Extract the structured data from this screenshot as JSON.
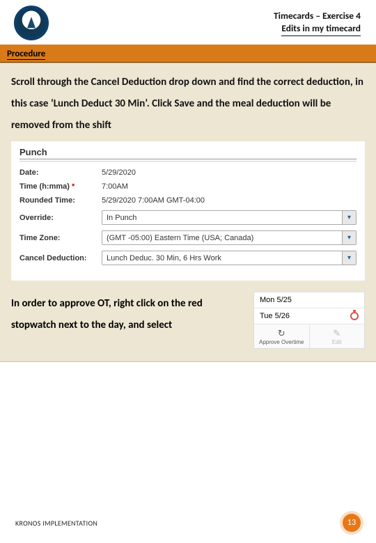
{
  "header": {
    "title_line1": "Timecards – Exercise 4",
    "title_line2": "Edits in my timecard"
  },
  "section_label": "Procedure",
  "instruction_text": "Scroll through the Cancel Deduction drop down and find the correct deduction, in this case ‘Lunch Deduct 30 Min’. Click Save and the meal deduction will be removed from the shift",
  "punch_form": {
    "title": "Punch",
    "rows": {
      "date_label": "Date:",
      "date_value": "5/29/2020",
      "time_label": "Time (h:mma)",
      "time_value": "7:00AM",
      "rounded_label": "Rounded Time:",
      "rounded_value": "5/29/2020 7:00AM GMT-04:00",
      "override_label": "Override:",
      "override_value": "In Punch",
      "tz_label": "Time Zone:",
      "tz_value": "(GMT -05:00) Eastern Time (USA; Canada)",
      "cancel_label": "Cancel Deduction:",
      "cancel_value": "Lunch Deduc. 30 Min, 6 Hrs Work"
    }
  },
  "approve_text": "In order to approve OT, right click on the red stopwatch next to the day, and select",
  "day_panel": {
    "day1": "Mon 5/25",
    "day2": "Tue 5/26",
    "action1_label": "Approve Overtime",
    "action2_label": "Edit"
  },
  "footer": {
    "text": "KRONOS IMPLEMENTATION",
    "page": "13"
  }
}
